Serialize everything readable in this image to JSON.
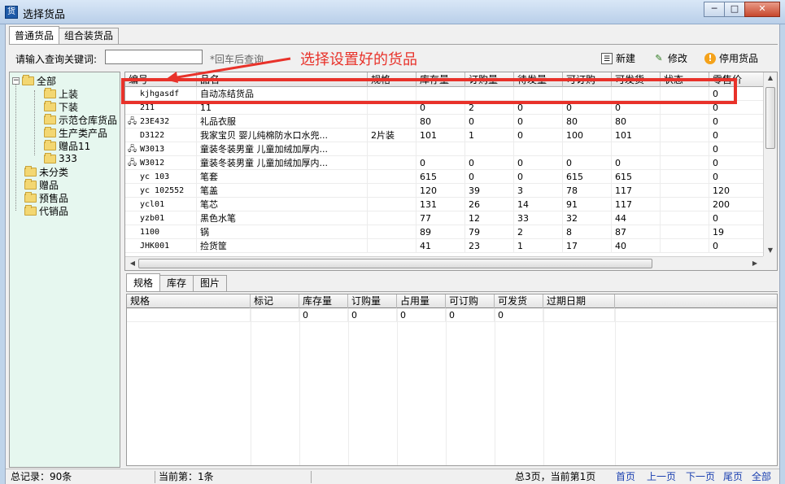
{
  "window": {
    "title": "选择货品",
    "app_icon": "货"
  },
  "tabs": [
    "普通货品",
    "组合装货品"
  ],
  "toolbar": {
    "search_label": "请输入查询关键词:",
    "search_value": "",
    "search_hint": "*回车后查询",
    "new_label": "新建",
    "edit_label": "修改",
    "disable_label": "停用货品"
  },
  "annotation": {
    "text": "选择设置好的货品",
    "color": "#e8322a"
  },
  "tree": {
    "root": "全部",
    "children": [
      "上装",
      "下装",
      "示范仓库货品",
      "生产类产品",
      "赠品11",
      "333"
    ],
    "others": [
      "未分类",
      "赠品",
      "预售品",
      "代销品"
    ]
  },
  "grid": {
    "columns": [
      "编号",
      "品名",
      "规格",
      "库存量",
      "订购量",
      "待发量",
      "可订购",
      "可发货",
      "状态",
      "零售价"
    ],
    "rows": [
      {
        "code": "kjhgasdf",
        "name": "自动冻结货品",
        "spec": "",
        "stock": "",
        "ordered": "",
        "pending": "",
        "orderable": "",
        "shippable": "",
        "price": "0",
        "icon": false
      },
      {
        "code": "211",
        "name": "11",
        "spec": "",
        "stock": "0",
        "ordered": "2",
        "pending": "0",
        "orderable": "0",
        "shippable": "0",
        "price": "0",
        "icon": false
      },
      {
        "code": "23E432",
        "name": "礼品衣服",
        "spec": "",
        "stock": "80",
        "ordered": "0",
        "pending": "0",
        "orderable": "80",
        "shippable": "80",
        "price": "0",
        "icon": true
      },
      {
        "code": "D3122",
        "name": "我家宝贝 婴儿纯棉防水口水兜...",
        "spec": "2片装",
        "stock": "101",
        "ordered": "1",
        "pending": "0",
        "orderable": "100",
        "shippable": "101",
        "price": "0",
        "icon": false
      },
      {
        "code": "W3013",
        "name": "童装冬装男童 儿童加绒加厚内...",
        "spec": "",
        "stock": "",
        "ordered": "",
        "pending": "",
        "orderable": "",
        "shippable": "",
        "price": "0",
        "icon": true
      },
      {
        "code": "W3012",
        "name": "童装冬装男童 儿童加绒加厚内...",
        "spec": "",
        "stock": "0",
        "ordered": "0",
        "pending": "0",
        "orderable": "0",
        "shippable": "0",
        "price": "0",
        "icon": true
      },
      {
        "code": "yc 103",
        "name": "笔套",
        "spec": "",
        "stock": "615",
        "ordered": "0",
        "pending": "0",
        "orderable": "615",
        "shippable": "615",
        "price": "0",
        "icon": false
      },
      {
        "code": "yc 102552",
        "name": "笔盖",
        "spec": "",
        "stock": "120",
        "ordered": "39",
        "pending": "3",
        "orderable": "78",
        "shippable": "117",
        "price": "120",
        "icon": false
      },
      {
        "code": "ycl01",
        "name": "笔芯",
        "spec": "",
        "stock": "131",
        "ordered": "26",
        "pending": "14",
        "orderable": "91",
        "shippable": "117",
        "price": "200",
        "icon": false
      },
      {
        "code": "yzb01",
        "name": "黑色水笔",
        "spec": "",
        "stock": "77",
        "ordered": "12",
        "pending": "33",
        "orderable": "32",
        "shippable": "44",
        "price": "0",
        "icon": false
      },
      {
        "code": "1100",
        "name": "锅",
        "spec": "",
        "stock": "89",
        "ordered": "79",
        "pending": "2",
        "orderable": "8",
        "shippable": "87",
        "price": "19",
        "icon": false
      },
      {
        "code": "JHK001",
        "name": "捡货筐",
        "spec": "",
        "stock": "41",
        "ordered": "23",
        "pending": "1",
        "orderable": "17",
        "shippable": "40",
        "price": "0",
        "icon": false
      }
    ]
  },
  "bottom_tabs": [
    "规格",
    "库存",
    "图片"
  ],
  "detail_grid": {
    "columns": [
      "规格",
      "标记",
      "库存量",
      "订购量",
      "占用量",
      "可订购",
      "可发货",
      "过期日期"
    ],
    "row": [
      "",
      "",
      "0",
      "0",
      "0",
      "0",
      "0",
      ""
    ]
  },
  "status": {
    "total": "总记录：90条",
    "current": "当前第：1条",
    "pages": "总3页，当前第1页",
    "first": "首页",
    "prev": "上一页",
    "next": "下一页",
    "last": "尾页",
    "all": "全部"
  }
}
